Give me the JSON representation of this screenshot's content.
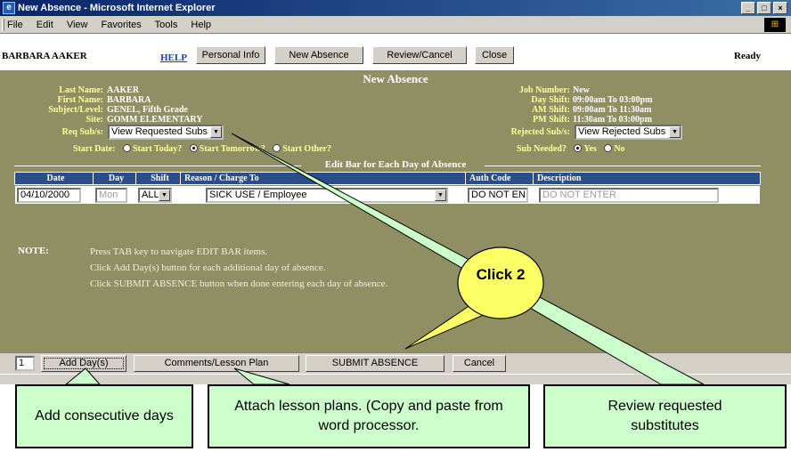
{
  "window": {
    "title": "New Absence - Microsoft Internet Explorer",
    "menu": [
      "File",
      "Edit",
      "View",
      "Favorites",
      "Tools",
      "Help"
    ],
    "controls": [
      "_",
      "□",
      "×"
    ]
  },
  "header": {
    "user": "BARBARA AAKER",
    "help": "HELP",
    "buttons": [
      "Personal Info",
      "New Absence",
      "Review/Cancel",
      "Close"
    ],
    "status": "Ready"
  },
  "form": {
    "title": "New Absence",
    "left_fields": [
      {
        "label": "Last Name:",
        "value": "AAKER"
      },
      {
        "label": "First Name:",
        "value": "BARBARA"
      },
      {
        "label": "Subject/Level:",
        "value": "GENEL, Fifth Grade"
      },
      {
        "label": "Site:",
        "value": "GOMM ELEMENTARY"
      }
    ],
    "right_fields": [
      {
        "label": "Job Number:",
        "value": "New"
      },
      {
        "label": "Day Shift:",
        "value": "09:00am To 03:00pm"
      },
      {
        "label": "AM Shift:",
        "value": "09:00am To 11:30am"
      },
      {
        "label": "PM Shift:",
        "value": "11:30am To 03:00pm"
      }
    ],
    "req_subs_label": "Req Sub/s:",
    "req_subs_value": "View Requested Subs",
    "rejected_subs_label": "Rejected Sub/s:",
    "rejected_subs_value": "View Rejected Subs",
    "start_date_label": "Start Date:",
    "start_options": [
      "Start Today?",
      "Start Tomorrow?",
      "Start Other?"
    ],
    "sub_needed_label": "Sub Needed?",
    "sub_needed_options": [
      "Yes",
      "No"
    ],
    "edit_bar_title": "Edit Bar for Each Day of Absence",
    "columns": [
      "Date",
      "Day",
      "Shift",
      "Reason / Charge To",
      "Auth Code",
      "Description"
    ],
    "row": {
      "date": "04/10/2000",
      "day": "Mon",
      "shift": "ALL",
      "reason": "SICK USE / Employee",
      "auth_code": "DO NOT EN",
      "description": "DO NOT ENTER"
    },
    "note_label": "NOTE:",
    "notes": [
      "Press TAB key to navigate EDIT BAR items.",
      "Click Add Day(s) button for each additional day of absence.",
      "Click SUBMIT ABSENCE button when done entering each day of absence."
    ]
  },
  "bottom": {
    "days_value": "1",
    "buttons": [
      "Add Day(s)",
      "Comments/Lesson Plan",
      "SUBMIT ABSENCE",
      "Cancel"
    ]
  },
  "callouts": {
    "click": "Click 2",
    "add_days": "Add consecutive days",
    "lesson_plans": "Attach lesson plans. (Copy and paste from word processor.",
    "review": "Review requested substitutes"
  },
  "colors": {
    "form_bg": "#8f8f63",
    "label_yellow": "#ffff99",
    "grid_header": "#2a4e8a",
    "callout_green": "#ccffcc",
    "balloon_yellow": "#ffff66"
  }
}
